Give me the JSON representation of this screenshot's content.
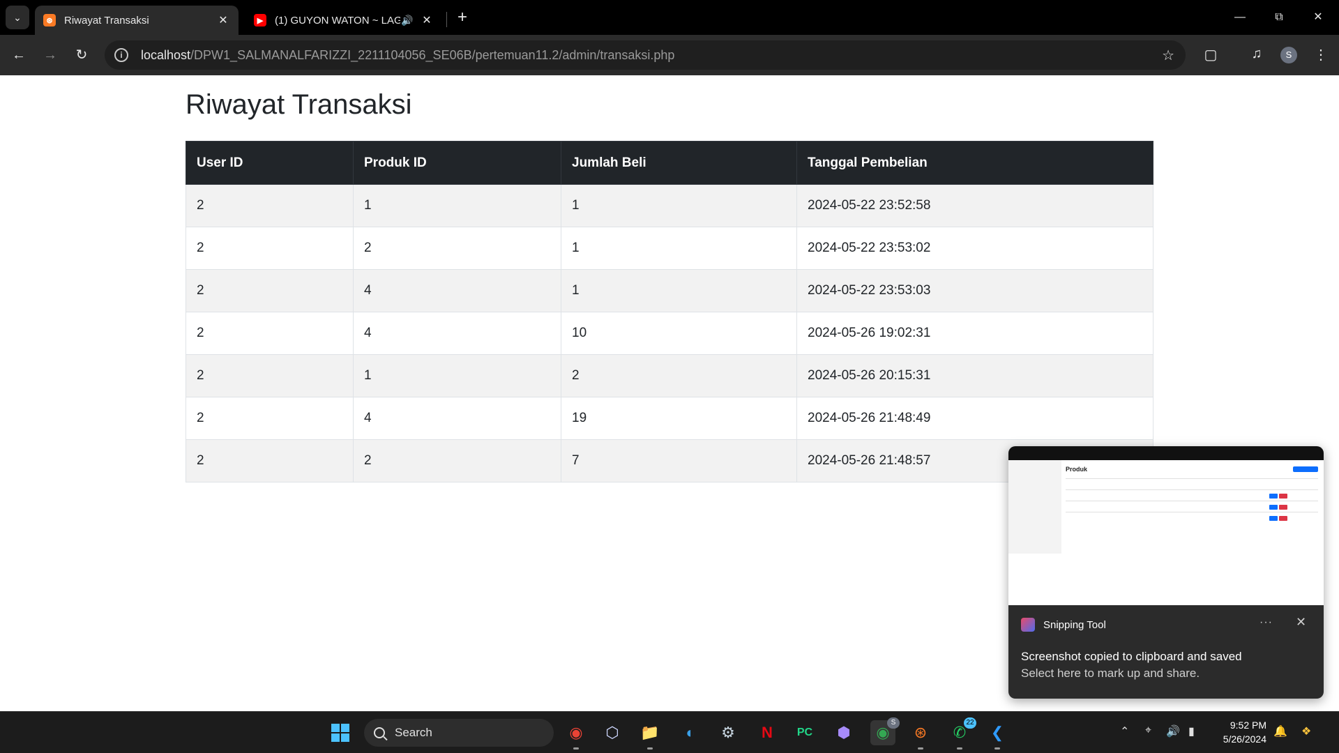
{
  "browser": {
    "tabs": [
      {
        "title": "Riwayat Transaksi",
        "active": true
      },
      {
        "title": "(1) GUYON WATON ~ LAGU",
        "active": false
      }
    ],
    "address": {
      "host": "localhost",
      "path": "/DPW1_SALMANALFARIZZI_2211104056_SE06B/pertemuan11.2/admin/transaksi.php"
    },
    "profile_initial": "S"
  },
  "page": {
    "title": "Riwayat Transaksi",
    "columns": [
      "User ID",
      "Produk ID",
      "Jumlah Beli",
      "Tanggal Pembelian"
    ],
    "rows": [
      [
        "2",
        "1",
        "1",
        "2024-05-22 23:52:58"
      ],
      [
        "2",
        "2",
        "1",
        "2024-05-22 23:53:02"
      ],
      [
        "2",
        "4",
        "1",
        "2024-05-22 23:53:03"
      ],
      [
        "2",
        "4",
        "10",
        "2024-05-26 19:02:31"
      ],
      [
        "2",
        "1",
        "2",
        "2024-05-26 20:15:31"
      ],
      [
        "2",
        "4",
        "19",
        "2024-05-26 21:48:49"
      ],
      [
        "2",
        "2",
        "7",
        "2024-05-26 21:48:57"
      ]
    ]
  },
  "toast": {
    "thumbnail_title": "Produk",
    "app_name": "Snipping Tool",
    "headline": "Screenshot copied to clipboard and saved",
    "subtext": "Select here to mark up and share."
  },
  "taskbar": {
    "search_label": "Search",
    "whatsapp_badge": "22",
    "chrome_badge": "S",
    "time": "9:52 PM",
    "date": "5/26/2024"
  },
  "colors": {
    "table_header_bg": "#212529",
    "stripe_bg": "#f2f2f2",
    "accent": "#4cc2ff"
  }
}
